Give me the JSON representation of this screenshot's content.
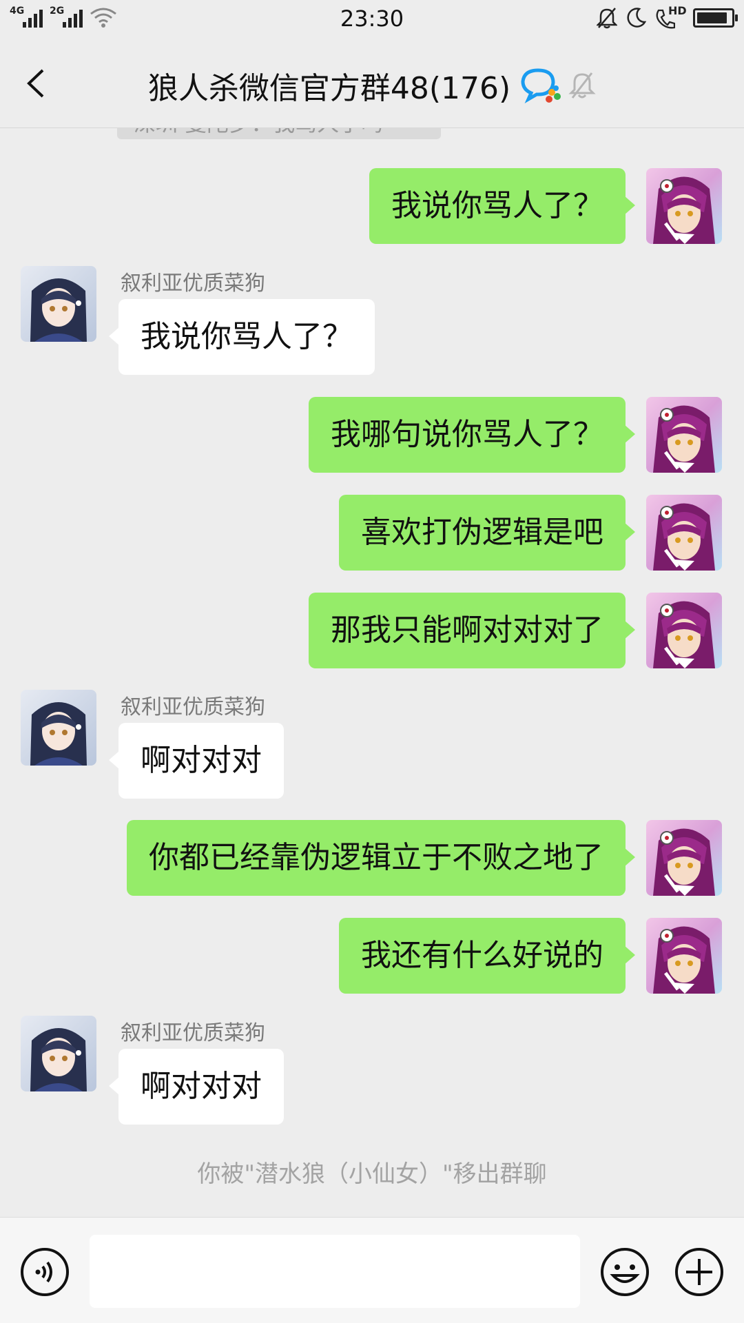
{
  "status_bar": {
    "time": "23:30",
    "signal_1_label": "4G",
    "signal_2_label": "2G",
    "hd_label": "HD",
    "battery_level": 0.9
  },
  "header": {
    "title": "狼人杀微信官方群48(176)",
    "back_icon": "chevron-left-icon",
    "group_icon": "wecom-group-icon",
    "mute_icon": "bell-muted-icon"
  },
  "chat": {
    "partial_top_message": "深圳 曼陀罗：我骂人了吗",
    "messages": [
      {
        "type": "sent",
        "text": "我说你骂人了？"
      },
      {
        "type": "received",
        "sender": "叙利亚优质菜狗",
        "text": "我说你骂人了？"
      },
      {
        "type": "sent",
        "text": "我哪句说你骂人了？"
      },
      {
        "type": "sent",
        "text": "喜欢打伪逻辑是吧"
      },
      {
        "type": "sent",
        "text": "那我只能啊对对对了"
      },
      {
        "type": "received",
        "sender": "叙利亚优质菜狗",
        "text": "啊对对对"
      },
      {
        "type": "sent",
        "text": "你都已经靠伪逻辑立于不败之地了"
      },
      {
        "type": "sent",
        "text": "我还有什么好说的"
      },
      {
        "type": "received",
        "sender": "叙利亚优质菜狗",
        "text": "啊对对对"
      }
    ],
    "system_message": "你被\"潜水狼（小仙女）\"移出群聊"
  },
  "input_bar": {
    "voice_icon": "voice-icon",
    "input_value": "",
    "emoji_icon": "emoji-icon",
    "plus_icon": "plus-icon"
  },
  "colors": {
    "sent_bubble": "#95ec69",
    "received_bubble": "#ffffff",
    "background": "#ededed"
  }
}
